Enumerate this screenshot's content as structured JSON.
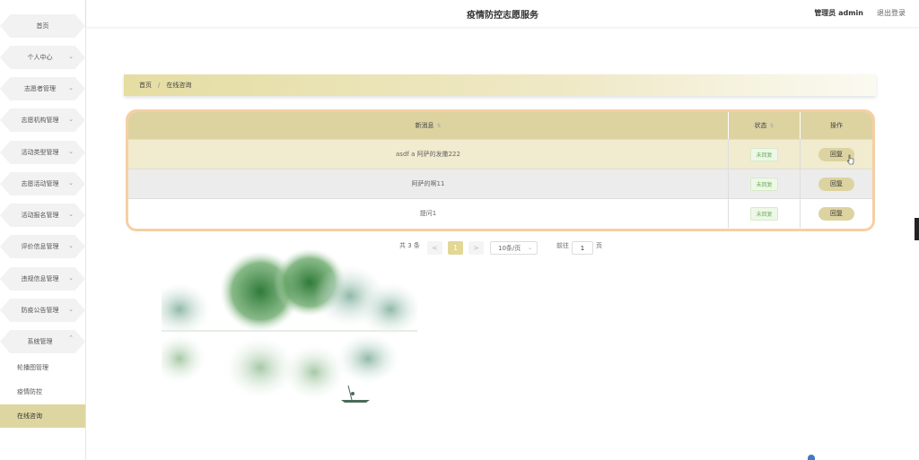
{
  "header": {
    "title": "疫情防控志愿服务",
    "user": "管理员 admin",
    "logout": "退出登录"
  },
  "sidebar": {
    "items": [
      {
        "label": "首页"
      },
      {
        "label": "个人中心"
      },
      {
        "label": "志愿者管理"
      },
      {
        "label": "志愿机构管理"
      },
      {
        "label": "活动类型管理"
      },
      {
        "label": "志愿活动管理"
      },
      {
        "label": "活动报名管理"
      },
      {
        "label": "评价信息管理"
      },
      {
        "label": "违规信息管理"
      },
      {
        "label": "防疫公告管理"
      },
      {
        "label": "系统管理"
      }
    ],
    "sub_items": [
      {
        "label": "轮播图管理"
      },
      {
        "label": "疫情防控"
      },
      {
        "label": "在线咨询"
      }
    ]
  },
  "breadcrumb": {
    "home": "首页",
    "separator": "/",
    "current": "在线咨询"
  },
  "table": {
    "headers": {
      "message": "新消息",
      "status": "状态",
      "action": "操作"
    },
    "rows": [
      {
        "message": "asdf a 阿萨的发撒222",
        "status": "未回复",
        "action": "回复"
      },
      {
        "message": "阿萨的啊11",
        "status": "未回复",
        "action": "回复"
      },
      {
        "message": "提问1",
        "status": "未回复",
        "action": "回复"
      }
    ]
  },
  "pagination": {
    "total": "共 3 条",
    "prev": "<",
    "current_page": "1",
    "next": ">",
    "page_size": "10条/页",
    "goto_label": "前往",
    "goto_value": "1",
    "page_unit": "页"
  },
  "colors": {
    "accent": "#ddd3a0",
    "table_border": "#f5cfa4",
    "active_menu": "#ddd6a0",
    "status_green": "#6bb05a"
  },
  "icons": [
    "chevron-down-icon",
    "chevron-up-icon",
    "sort-icon",
    "cursor-icon"
  ]
}
